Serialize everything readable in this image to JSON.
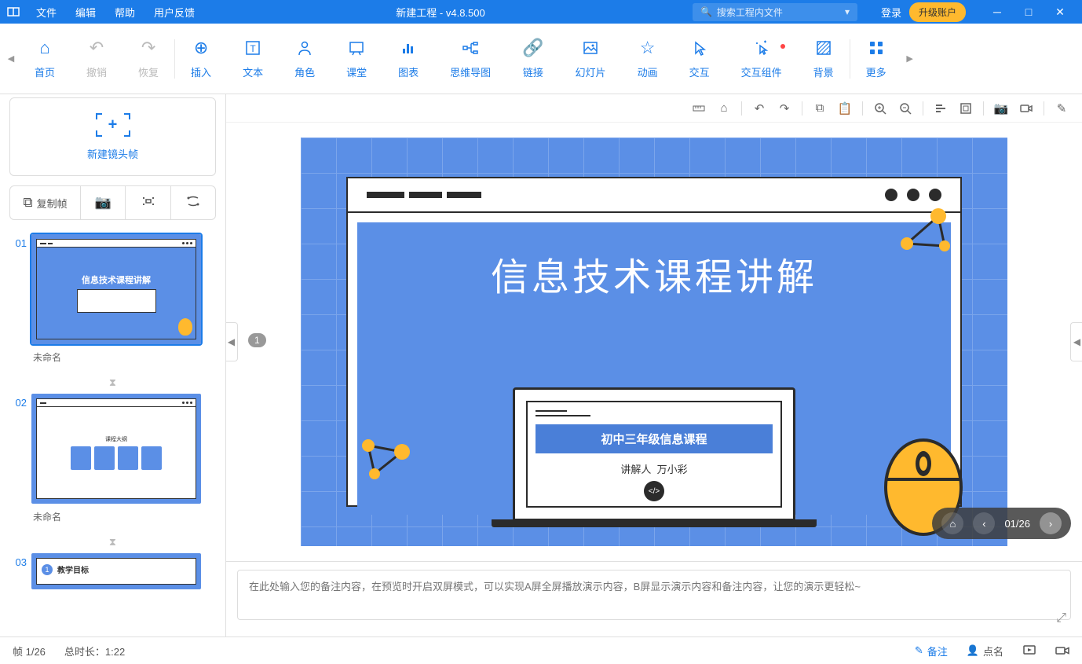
{
  "titleBar": {
    "menus": {
      "file": "文件",
      "edit": "编辑",
      "help": "帮助",
      "feedback": "用户反馈"
    },
    "title": "新建工程 - v4.8.500",
    "searchPlaceholder": "搜索工程内文件",
    "login": "登录",
    "upgrade": "升级账户"
  },
  "toolbar": {
    "home": "首页",
    "undo": "撤销",
    "redo": "恢复",
    "insert": "插入",
    "text": "文本",
    "character": "角色",
    "classroom": "课堂",
    "chart": "图表",
    "mindmap": "思维导图",
    "link": "链接",
    "slideshow": "幻灯片",
    "animation": "动画",
    "interaction": "交互",
    "interactiveWidget": "交互组件",
    "background": "背景",
    "more": "更多"
  },
  "leftPanel": {
    "newFrame": "新建镜头帧",
    "copyFrame": "复制帧",
    "slides": [
      {
        "num": "01",
        "title": "未命名"
      },
      {
        "num": "02",
        "title": "未命名"
      },
      {
        "num": "03",
        "title": ""
      }
    ],
    "slide1Text": "信息技术课程讲解",
    "slide2Text": "课程大纲",
    "slide3Text": "教学目标"
  },
  "canvas": {
    "frameBadge": "1",
    "mainTitle": "信息技术课程讲解",
    "subtitle": "初中三年级信息课程",
    "presenterLabel": "讲解人",
    "presenterName": "万小彩",
    "codeIcon": "</>",
    "pageIndicator": "01/26"
  },
  "notes": {
    "placeholder": "在此处输入您的备注内容，在预览时开启双屏模式，可以实现A屏全屏播放演示内容，B屏显示演示内容和备注内容，让您的演示更轻松~"
  },
  "statusBar": {
    "frame": "帧 1/26",
    "duration": "总时长：1:22",
    "notes": "备注",
    "rollcall": "点名"
  }
}
